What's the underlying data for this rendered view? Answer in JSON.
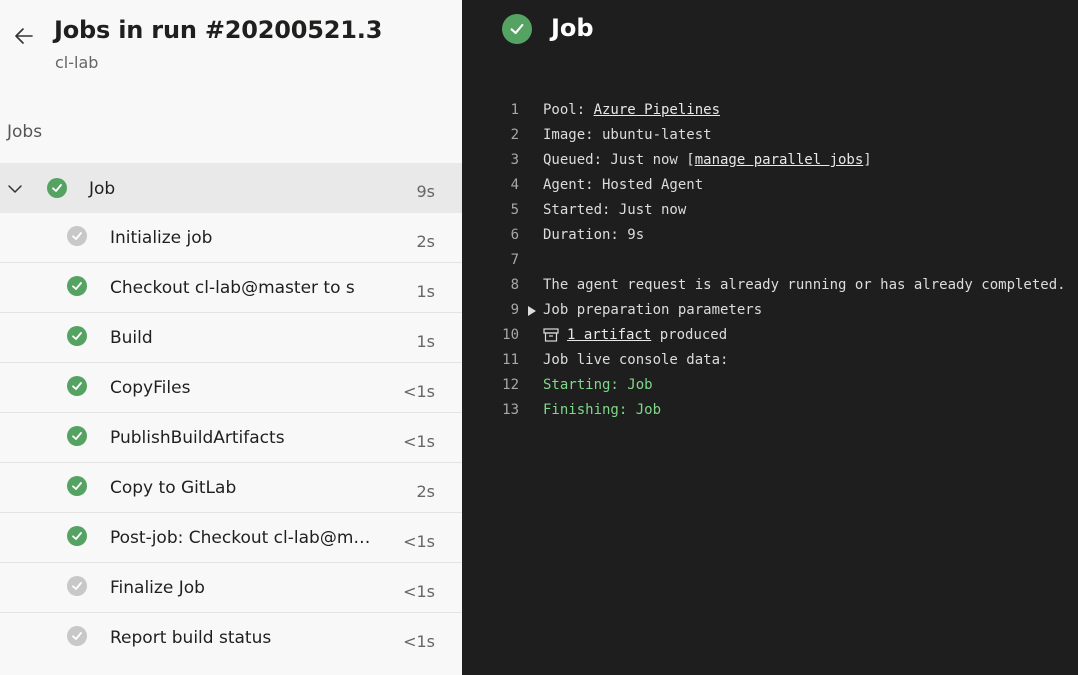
{
  "header": {
    "title": "Jobs in run #20200521.3",
    "subtitle": "cl-lab"
  },
  "jobs_section": {
    "label": "Jobs"
  },
  "job": {
    "label": "Job",
    "duration": "9s",
    "status": "succeeded"
  },
  "steps": [
    {
      "label": "Initialize job",
      "duration": "2s",
      "status": "completed"
    },
    {
      "label": "Checkout cl-lab@master to s",
      "duration": "1s",
      "status": "succeeded"
    },
    {
      "label": "Build",
      "duration": "1s",
      "status": "succeeded"
    },
    {
      "label": "CopyFiles",
      "duration": "<1s",
      "status": "succeeded"
    },
    {
      "label": "PublishBuildArtifacts",
      "duration": "<1s",
      "status": "succeeded"
    },
    {
      "label": "Copy to GitLab",
      "duration": "2s",
      "status": "succeeded"
    },
    {
      "label": "Post-job: Checkout cl-lab@master to s",
      "duration": "<1s",
      "status": "succeeded"
    },
    {
      "label": "Finalize Job",
      "duration": "<1s",
      "status": "completed"
    },
    {
      "label": "Report build status",
      "duration": "<1s",
      "status": "completed"
    }
  ],
  "console": {
    "title": "Job",
    "lines": {
      "l1": {
        "num": "1",
        "prefix": "Pool: ",
        "link": "Azure Pipelines"
      },
      "l2": {
        "num": "2",
        "text": "Image: ubuntu-latest"
      },
      "l3": {
        "num": "3",
        "prefix": "Queued: Just now [",
        "link": "manage parallel jobs",
        "suffix": "]"
      },
      "l4": {
        "num": "4",
        "text": "Agent: Hosted Agent"
      },
      "l5": {
        "num": "5",
        "text": "Started: Just now"
      },
      "l6": {
        "num": "6",
        "text": "Duration: 9s"
      },
      "l7": {
        "num": "7",
        "text": ""
      },
      "l8": {
        "num": "8",
        "text": "The agent request is already running or has already completed."
      },
      "l9": {
        "num": "9",
        "text": "Job preparation parameters"
      },
      "l10": {
        "num": "10",
        "link": "1 artifact",
        "suffix": " produced"
      },
      "l11": {
        "num": "11",
        "text": "Job live console data:"
      },
      "l12": {
        "num": "12",
        "text": "Starting: Job"
      },
      "l13": {
        "num": "13",
        "text": "Finishing: Job"
      }
    }
  },
  "colors": {
    "success": "#55a362",
    "completed": "#c8c8c8",
    "console_bg": "#1e1e1e",
    "console_green": "#7fd889"
  }
}
